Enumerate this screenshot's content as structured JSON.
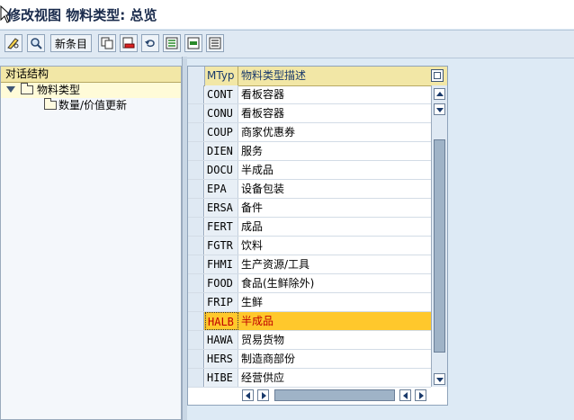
{
  "title": "修改视图 物料类型: 总览",
  "toolbar": {
    "new_entries_label": "新条目"
  },
  "tree": {
    "header": "对话结构",
    "root_label": "物料类型",
    "child_label": "数量/价值更新"
  },
  "grid": {
    "col1_header": "MTyp",
    "col2_header": "物料类型描述",
    "rows": [
      {
        "code": "CONT",
        "desc": "看板容器"
      },
      {
        "code": "CONU",
        "desc": "看板容器"
      },
      {
        "code": "COUP",
        "desc": "商家优惠券"
      },
      {
        "code": "DIEN",
        "desc": "服务"
      },
      {
        "code": "DOCU",
        "desc": "半成品"
      },
      {
        "code": "EPA",
        "desc": "设备包装"
      },
      {
        "code": "ERSA",
        "desc": "备件"
      },
      {
        "code": "FERT",
        "desc": "成品"
      },
      {
        "code": "FGTR",
        "desc": "饮料"
      },
      {
        "code": "FHMI",
        "desc": "生产资源/工具"
      },
      {
        "code": "FOOD",
        "desc": "食品(生鲜除外)"
      },
      {
        "code": "FRIP",
        "desc": "生鲜"
      },
      {
        "code": "HALB",
        "desc": "半成品"
      },
      {
        "code": "HAWA",
        "desc": "贸易货物"
      },
      {
        "code": "HERS",
        "desc": "制造商部份"
      },
      {
        "code": "HIBE",
        "desc": "经营供应"
      }
    ],
    "selected_row": 12
  }
}
